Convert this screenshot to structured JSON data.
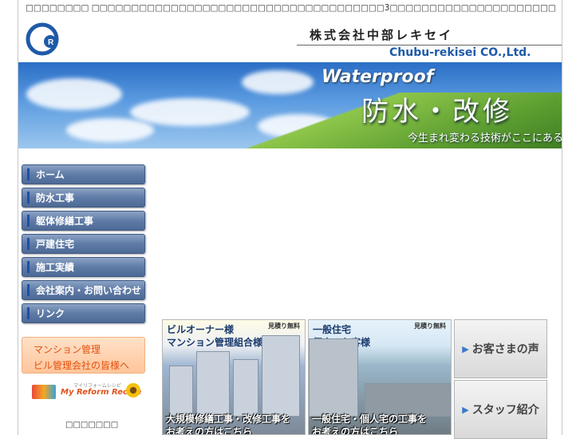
{
  "header": {
    "topline": "□□□□□□□□ □□□□□□□□□□□□□□□□□□□□□□□□□□□□□□□□□□□□□3□□□□□□□□□□□□□□□□□□□□□",
    "company_jp": "株式会社中部レキセイ",
    "company_en": "Chubu-rekisei CO.,Ltd.",
    "logo_icon": "company-logo-icon"
  },
  "banner": {
    "english": "Waterproof",
    "japanese": "防水・改修",
    "tagline": "今生まれ変わる技術がここにある"
  },
  "nav": {
    "items": [
      {
        "label": "ホーム"
      },
      {
        "label": "防水工事"
      },
      {
        "label": "躯体修繕工事"
      },
      {
        "label": "戸建住宅"
      },
      {
        "label": "施工実績"
      },
      {
        "label": "会社案内・お問い合わせ"
      },
      {
        "label": "リンク"
      }
    ]
  },
  "mansion": {
    "line1": "マンション管理",
    "line2": "ビル管理会社の皆様へ"
  },
  "recipe": {
    "sub": "マイリフォームレシピ",
    "main": "My Reform Recipe"
  },
  "left_bottom": "□□□□□□□",
  "promos": [
    {
      "line1": "ビルオーナー様",
      "line2": "マンション管理組合様",
      "badge": "見積り無料",
      "foot1": "大規模修繕工事・改修工事を",
      "foot2": "お考えの方はこちら"
    },
    {
      "line1": "一般住宅",
      "line2": "個人のお客様",
      "badge": "見積り無料",
      "foot1": "一般住宅・個人宅の工事を",
      "foot2": "お考えの方はこちら"
    }
  ],
  "side": {
    "voice": "お客さまの声",
    "staff": "スタッフ紹介"
  },
  "colors": {
    "accent": "#1e5aa8",
    "nav": "#5f7ba6",
    "orange": "#e2500f"
  }
}
